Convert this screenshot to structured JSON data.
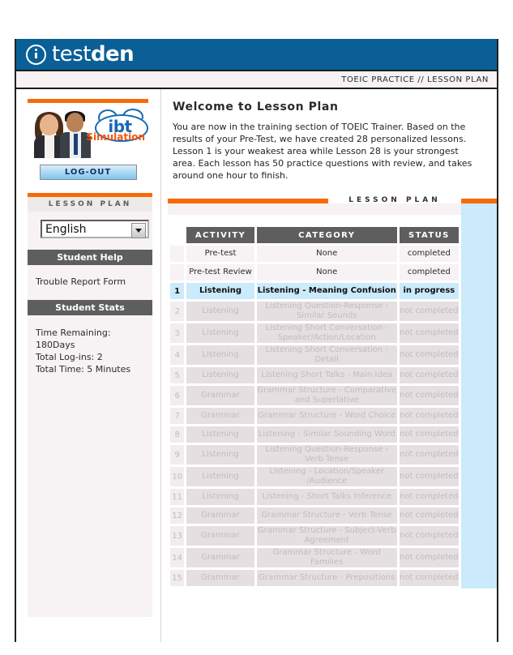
{
  "brand": {
    "icon": "info-circle-icon",
    "name_light": "test",
    "name_bold": "den"
  },
  "breadcrumb": "TOEIC PRACTICE // LESSON PLAN",
  "sidebar": {
    "logo": {
      "ibt_label": "ibt",
      "simulation_label": "Simulation",
      "alt": "ibt-simulation-logo"
    },
    "logout_label": "LOG-OUT",
    "nav_title": "LESSON PLAN",
    "language_select": {
      "value": "English",
      "options": [
        "English"
      ]
    },
    "student_help": {
      "heading": "Student Help",
      "links": [
        "Trouble Report Form"
      ]
    },
    "student_stats": {
      "heading": "Student Stats",
      "lines": [
        "Time Remaining: 180Days",
        "Total Log-ins: 2",
        "Total Time: 5 Minutes"
      ]
    }
  },
  "main": {
    "heading": "Welcome to Lesson Plan",
    "intro": "You are now in the training section of TOEIC Trainer. Based on the results of your Pre-Test, we have created 28 personalized lessons. Lesson 1 is your weakest area while Lesson 28 is your strongest area. Each lesson has 50 practice questions with review, and takes around one hour to finish.",
    "section_label": "LESSON PLAN",
    "table": {
      "columns": [
        "",
        "ACTIVITY",
        "CATEGORY",
        "STATUS"
      ],
      "rows": [
        {
          "num": "",
          "activity": "Pre-test",
          "category": "None",
          "status": "completed",
          "state": "done"
        },
        {
          "num": "",
          "activity": "Pre-test Review",
          "category": "None",
          "status": "completed",
          "state": "done"
        },
        {
          "num": "1",
          "activity": "Listening",
          "category": "Listening - Meaning Confusion",
          "status": "in progress",
          "state": "active"
        },
        {
          "num": "2",
          "activity": "Listening",
          "category": "Listening Question-Response - Similar Sounds",
          "status": "not completed",
          "state": "locked"
        },
        {
          "num": "3",
          "activity": "Listening",
          "category": "Listening Short Conversation - Speaker/Action/Location",
          "status": "not completed",
          "state": "locked"
        },
        {
          "num": "4",
          "activity": "Listening",
          "category": "Listening Short Conversation - Detail",
          "status": "not completed",
          "state": "locked"
        },
        {
          "num": "5",
          "activity": "Listening",
          "category": "Listening Short Talks - Main Idea",
          "status": "not completed",
          "state": "locked"
        },
        {
          "num": "6",
          "activity": "Grammar",
          "category": "Grammar Structure - Comparative and Superlative",
          "status": "not completed",
          "state": "locked"
        },
        {
          "num": "7",
          "activity": "Grammar",
          "category": "Grammar Structure - Word Choice",
          "status": "not completed",
          "state": "locked"
        },
        {
          "num": "8",
          "activity": "Listening",
          "category": "Listening - Similar Sounding Word",
          "status": "not completed",
          "state": "locked"
        },
        {
          "num": "9",
          "activity": "Listening",
          "category": "Listening Question-Response - Verb Tense",
          "status": "not completed",
          "state": "locked"
        },
        {
          "num": "10",
          "activity": "Listening",
          "category": "Listening - Location/Speaker /Audience",
          "status": "not completed",
          "state": "locked"
        },
        {
          "num": "11",
          "activity": "Listening",
          "category": "Listening - Short Talks Inference",
          "status": "not completed",
          "state": "locked"
        },
        {
          "num": "12",
          "activity": "Grammar",
          "category": "Grammar Structure - Verb Tense",
          "status": "not completed",
          "state": "locked"
        },
        {
          "num": "13",
          "activity": "Grammar",
          "category": "Grammar Structure - Subject-Verb Agreement",
          "status": "not completed",
          "state": "locked"
        },
        {
          "num": "14",
          "activity": "Grammar",
          "category": "Grammar Structure - Word Families",
          "status": "not completed",
          "state": "locked"
        },
        {
          "num": "15",
          "activity": "Grammar",
          "category": "Grammar Structure - Prepositions",
          "status": "not completed",
          "state": "locked"
        }
      ]
    }
  },
  "colors": {
    "brand_blue": "#0a6096",
    "accent_orange": "#f96a07",
    "header_gray": "#5e5e5e",
    "active_blue": "#cbeafb",
    "cell_pink": "#f7f2f4",
    "locked_gray": "#e5dfe1"
  }
}
